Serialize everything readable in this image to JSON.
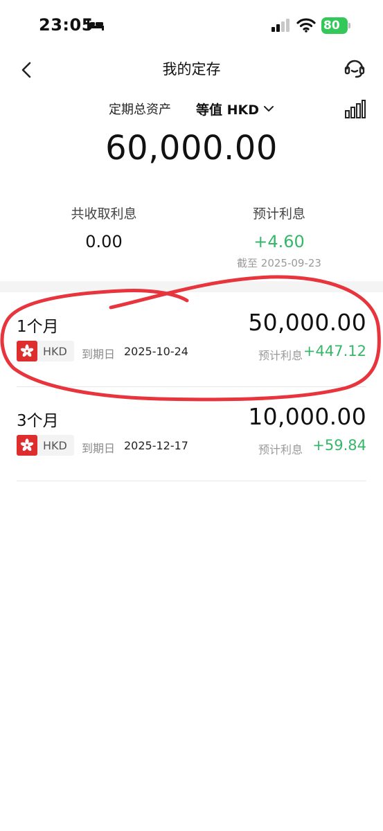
{
  "status_bar": {
    "time": "23:05",
    "battery": "80",
    "icons": [
      "bed-icon",
      "cellular-signal-icon",
      "wifi-icon",
      "battery-charging-icon"
    ]
  },
  "nav": {
    "title": "我的定存",
    "back_icon": "chevron-left-icon",
    "support_icon": "customer-service-headset-icon"
  },
  "summary": {
    "asset_label": "定期总资产",
    "currency_selector": "等值 HKD",
    "total_amount": "60,000.00",
    "collected_interest_label": "共收取利息",
    "collected_interest_value": "0.00",
    "expected_interest_label": "预计利息",
    "expected_interest_value": "+4.60",
    "as_of_prefix": "截至",
    "as_of_date": "2025-09-23"
  },
  "deposits": [
    {
      "term": "1个月",
      "amount": "50,000.00",
      "currency": "HKD",
      "maturity_label": "到期日",
      "maturity_date": "2025-10-24",
      "expected_label": "预计利息",
      "expected_value": "+447.12"
    },
    {
      "term": "3个月",
      "amount": "10,000.00",
      "currency": "HKD",
      "maturity_label": "到期日",
      "maturity_date": "2025-12-17",
      "expected_label": "预计利息",
      "expected_value": "+59.84"
    }
  ],
  "colors": {
    "positive_green": "#35b768",
    "battery_green": "#34c759",
    "flag_red": "#de2d2d",
    "annotation_red": "#e8343c"
  }
}
